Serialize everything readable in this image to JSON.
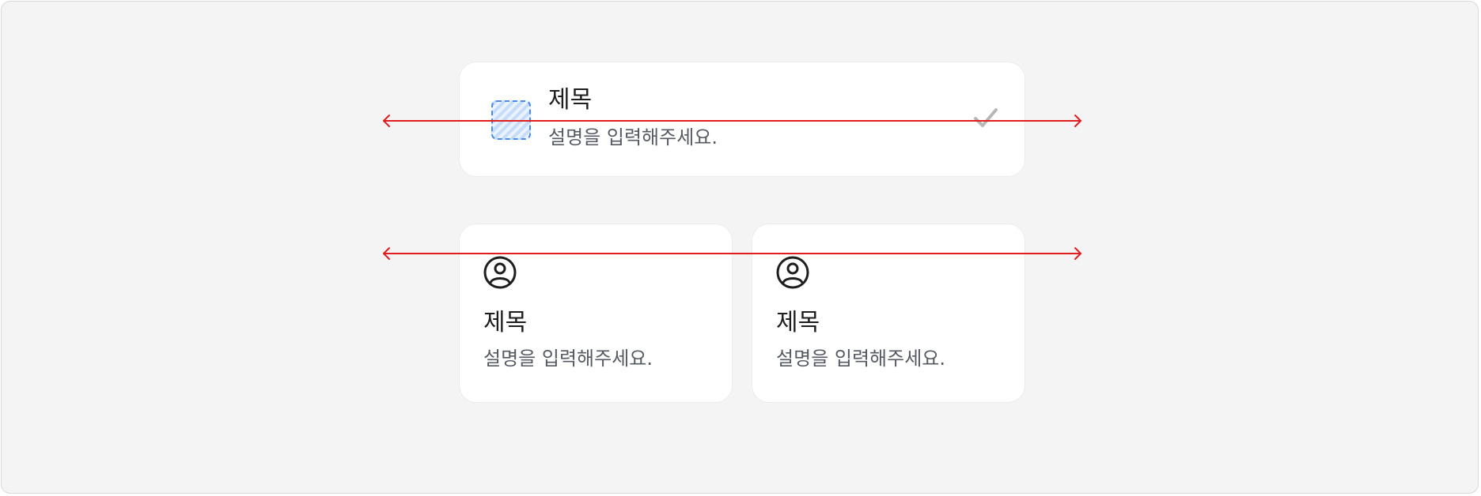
{
  "list_card": {
    "title": "제목",
    "description": "설명을 입력해주세요.",
    "thumbnail_icon": "placeholder-image",
    "trailing_icon": "check-icon"
  },
  "grid_cards": [
    {
      "icon": "user-circle-icon",
      "title": "제목",
      "description": "설명을 입력해주세요."
    },
    {
      "icon": "user-circle-icon",
      "title": "제목",
      "description": "설명을 입력해주세요."
    }
  ],
  "colors": {
    "canvas": "#f4f4f4",
    "card": "#ffffff",
    "title_text": "#1e1e1e",
    "description_text": "#555a63",
    "placeholder_accent": "#4a8bf0",
    "check": "#b7b7b7",
    "measure_line": "#e11d1d"
  }
}
